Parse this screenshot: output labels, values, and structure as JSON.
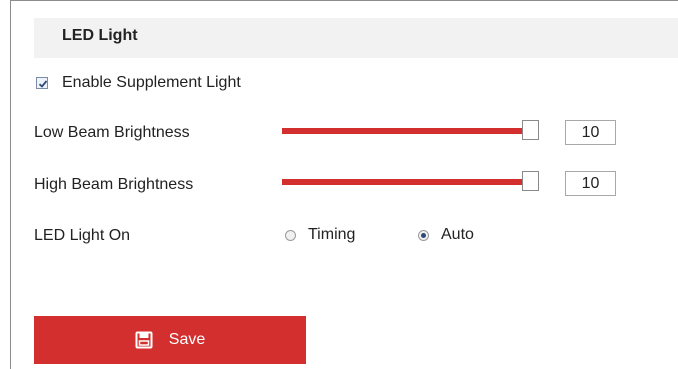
{
  "section": {
    "title": "LED Light"
  },
  "enable": {
    "label": "Enable Supplement Light",
    "checked": true
  },
  "low_beam": {
    "label": "Low Beam Brightness",
    "value": "10",
    "fraction": 0.94
  },
  "high_beam": {
    "label": "High Beam Brightness",
    "value": "10",
    "fraction": 0.94
  },
  "led_on": {
    "label": "LED Light On",
    "options": [
      {
        "label": "Timing",
        "checked": false
      },
      {
        "label": "Auto",
        "checked": true
      }
    ]
  },
  "save": {
    "label": "Save",
    "icon": "save-icon"
  },
  "colors": {
    "accent": "#d32f2f",
    "header_bg": "#f2f2f2"
  }
}
